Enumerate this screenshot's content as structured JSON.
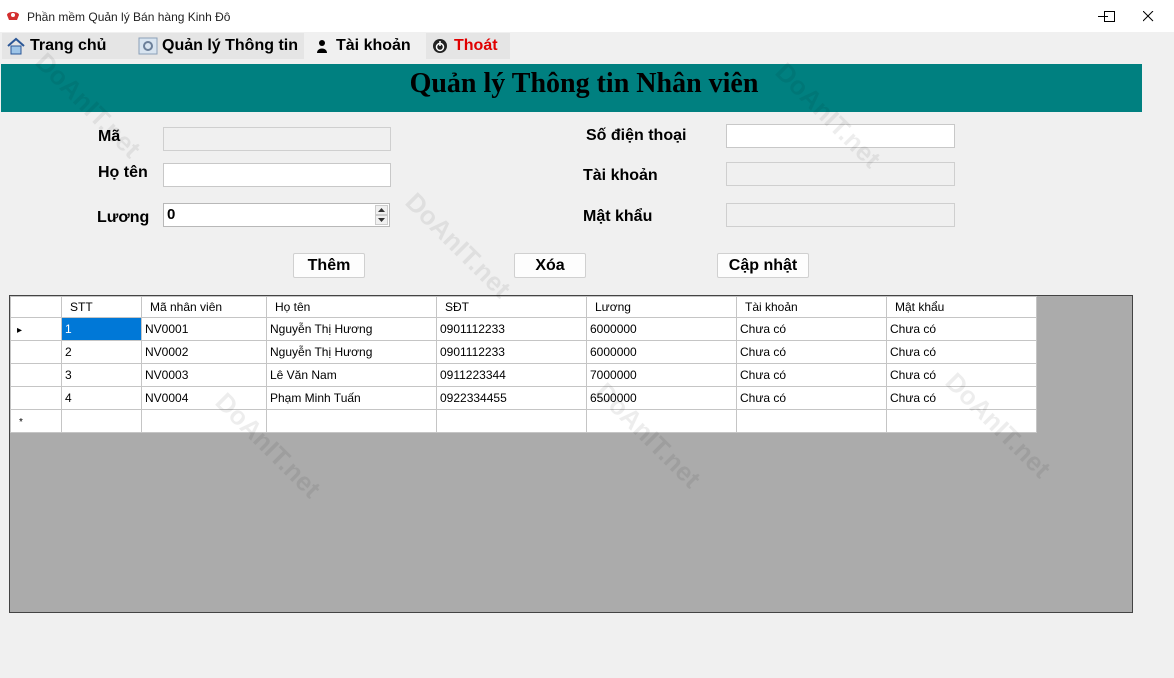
{
  "window": {
    "title": "Phần mềm Quản lý Bán hàng Kinh Đô",
    "controls": [
      "minimize-icon",
      "maximize-icon",
      "close-icon"
    ]
  },
  "menu": {
    "items": [
      {
        "label": "Trang chủ",
        "icon": "home-icon"
      },
      {
        "label": "Quản lý Thông tin",
        "icon": "settings-icon"
      },
      {
        "label": "Tài khoản",
        "icon": "user-icon"
      },
      {
        "label": "Thoát",
        "icon": "power-icon",
        "color": "#e00000"
      }
    ]
  },
  "banner": {
    "title": "Quản lý Thông tin Nhân viên",
    "color": "#008080"
  },
  "form": {
    "ma_label": "Mã",
    "ma_value": "",
    "hoten_label": "Họ tên",
    "hoten_value": "",
    "luong_label": "Lương",
    "luong_value": "0",
    "sdt_label": "Số điện thoại",
    "sdt_value": "",
    "taikhoan_label": "Tài khoản",
    "taikhoan_value": "",
    "matkhau_label": "Mật khẩu",
    "matkhau_value": ""
  },
  "buttons": {
    "add": "Thêm",
    "delete": "Xóa",
    "update": "Cập nhật"
  },
  "grid": {
    "columns": [
      "STT",
      "Mã nhân viên",
      "Họ tên",
      "SĐT",
      "Lương",
      "Tài khoản",
      "Mật khẩu"
    ],
    "rows": [
      [
        "1",
        "NV0001",
        "Nguyễn Thị Hương",
        "0901112233",
        "6000000",
        "Chưa có",
        "Chưa có"
      ],
      [
        "2",
        "NV0002",
        "Nguyễn Thị Hương",
        "0901112233",
        "6000000",
        "Chưa có",
        "Chưa có"
      ],
      [
        "3",
        "NV0003",
        "Lê Văn Nam",
        "0911223344",
        "7000000",
        "Chưa có",
        "Chưa có"
      ],
      [
        "4",
        "NV0004",
        "Phạm Minh Tuấn",
        "0922334455",
        "6500000",
        "Chưa có",
        "Chưa có"
      ]
    ],
    "current_row_marker": "▸",
    "new_row_marker": "*",
    "selection_color": "#0078d7",
    "background_color": "#ababab"
  },
  "watermark": {
    "text": "DoAnIT.net"
  }
}
